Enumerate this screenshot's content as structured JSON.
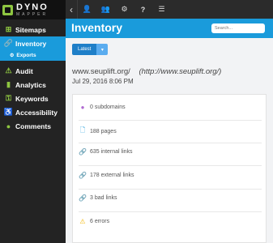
{
  "app": {
    "logo_main": "DYNO",
    "logo_sub": "MAPPER"
  },
  "sidebar": {
    "items": [
      {
        "label": "Sitemaps",
        "icon": "sitemap-icon",
        "glyph": "⊞",
        "color": "#8ec641"
      },
      {
        "label": "Inventory",
        "icon": "link-icon",
        "glyph": "🔗",
        "color": "#ffffff"
      },
      {
        "label": "Audit",
        "icon": "warning-icon",
        "glyph": "⚠",
        "color": "#8ec641"
      },
      {
        "label": "Analytics",
        "icon": "bar-chart-icon",
        "glyph": "▮",
        "color": "#8ec641"
      },
      {
        "label": "Keywords",
        "icon": "key-icon",
        "glyph": "⚿",
        "color": "#8ec641"
      },
      {
        "label": "Accessibility",
        "icon": "accessibility-icon",
        "glyph": "♿",
        "color": "#8ec641"
      },
      {
        "label": "Comments",
        "icon": "comment-icon",
        "glyph": "●",
        "color": "#8ec641"
      }
    ],
    "sub_item": {
      "label": "Exports",
      "icon": "gear-icon",
      "glyph": "⚙"
    }
  },
  "topbar": {
    "icons": [
      {
        "name": "back-chevron-icon",
        "glyph": "‹"
      },
      {
        "name": "user-icon",
        "glyph": "👤"
      },
      {
        "name": "team-icon",
        "glyph": "👥"
      },
      {
        "name": "settings-icon",
        "glyph": "⚙"
      },
      {
        "name": "help-icon",
        "glyph": "?"
      },
      {
        "name": "menu-icon",
        "glyph": "☰"
      }
    ]
  },
  "header": {
    "title": "Inventory",
    "search_placeholder": "Search..."
  },
  "version_button": {
    "label": "Latest",
    "caret": "▾"
  },
  "site": {
    "name": "www.seuplift.org/",
    "url": "(http://www.seuplift.org/)",
    "date": "Jul 29, 2016 8:06 PM"
  },
  "stats": [
    {
      "text": "0 subdomains",
      "icon": "subdomain-icon",
      "glyph": "●",
      "color": "#b06ad1"
    },
    {
      "text": "188 pages",
      "icon": "page-icon",
      "glyph": "🗋",
      "color": "#1a9bdb"
    },
    {
      "text": "635 internal links",
      "icon": "link-icon",
      "glyph": "🔗",
      "color": "#5cae2d"
    },
    {
      "text": "178 external links",
      "icon": "external-link-icon",
      "glyph": "🔗",
      "color": "#5cae2d"
    },
    {
      "text": "3 bad links",
      "icon": "broken-link-icon",
      "glyph": "🔗",
      "color": "#e04a4a"
    },
    {
      "text": "6 errors",
      "icon": "warning-icon",
      "glyph": "⚠",
      "color": "#f2b705"
    }
  ]
}
